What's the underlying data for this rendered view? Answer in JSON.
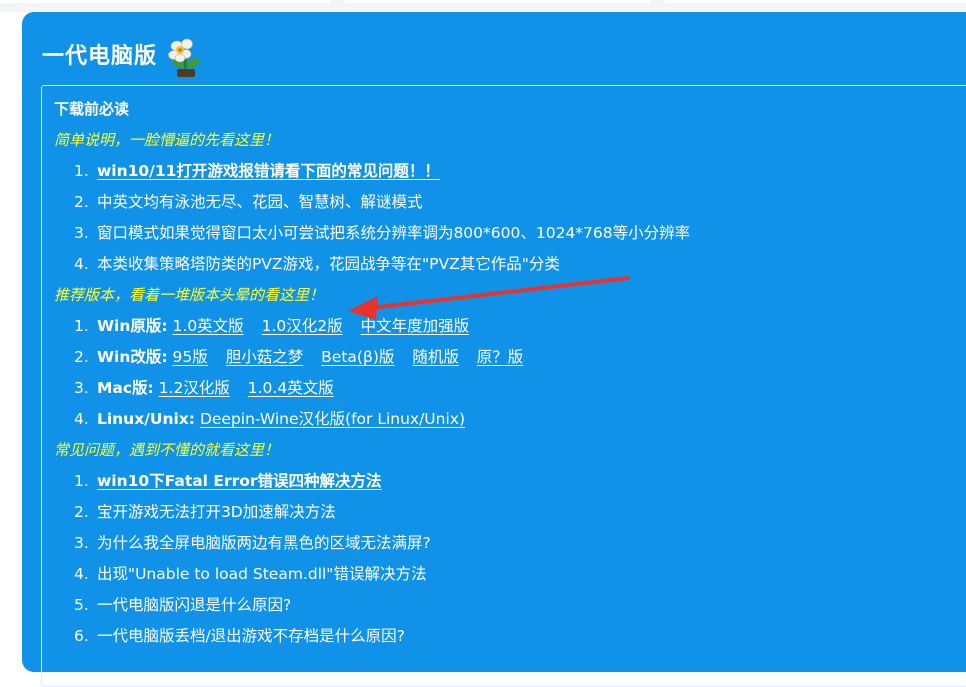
{
  "panel": {
    "title": "一代电脑版",
    "icon": "plant-flower-icon",
    "accent_color": "#0f92e8",
    "highlight_color": "#ffff2a"
  },
  "content": {
    "heading": "下载前必读",
    "sections": [
      {
        "title": "简单说明，一脸懵逼的先看这里！",
        "items": [
          {
            "num": "1.",
            "link": "win10/11打开游戏报错请看下面的常见问题！！"
          },
          {
            "num": "2.",
            "text": "中英文均有泳池无尽、花园、智慧树、解谜模式"
          },
          {
            "num": "3.",
            "text": "窗口模式如果觉得窗口太小可尝试把系统分辨率调为800*600、1024*768等小分辨率"
          },
          {
            "num": "4.",
            "text": "本类收集策略塔防类的PVZ游戏，花园战争等在\"PVZ其它作品\"分类"
          }
        ]
      },
      {
        "title": "推荐版本，看着一堆版本头晕的看这里！",
        "items": [
          {
            "num": "1.",
            "label": "Win原版:",
            "links": [
              "1.0英文版",
              "1.0汉化2版",
              "中文年度加强版"
            ]
          },
          {
            "num": "2.",
            "label": "Win改版:",
            "links": [
              "95版",
              "胆小菇之梦",
              "Beta(β)版",
              "随机版",
              "原？版"
            ]
          },
          {
            "num": "3.",
            "label": "Mac版:",
            "links": [
              "1.2汉化版",
              "1.0.4英文版"
            ]
          },
          {
            "num": "4.",
            "label": "Linux/Unix:",
            "links": [
              "Deepin-Wine汉化版(for Linux/Unix)"
            ]
          }
        ]
      },
      {
        "title": "常见问题，遇到不懂的就看这里！",
        "items": [
          {
            "num": "1.",
            "link": "win10下Fatal Error错误四种解决方法"
          },
          {
            "num": "2.",
            "text": "宝开游戏无法打开3D加速解决方法"
          },
          {
            "num": "3.",
            "text": "为什么我全屏电脑版两边有黑色的区域无法满屏?"
          },
          {
            "num": "4.",
            "text": "出现\"Unable to load Steam.dll\"错误解决方法"
          },
          {
            "num": "5.",
            "text": "一代电脑版闪退是什么原因?"
          },
          {
            "num": "6.",
            "text": "一代电脑版丢档/退出游戏不存档是什么原因?"
          }
        ]
      }
    ]
  },
  "annotation": {
    "icon": "red-arrow-icon",
    "color": "#e8322c"
  }
}
